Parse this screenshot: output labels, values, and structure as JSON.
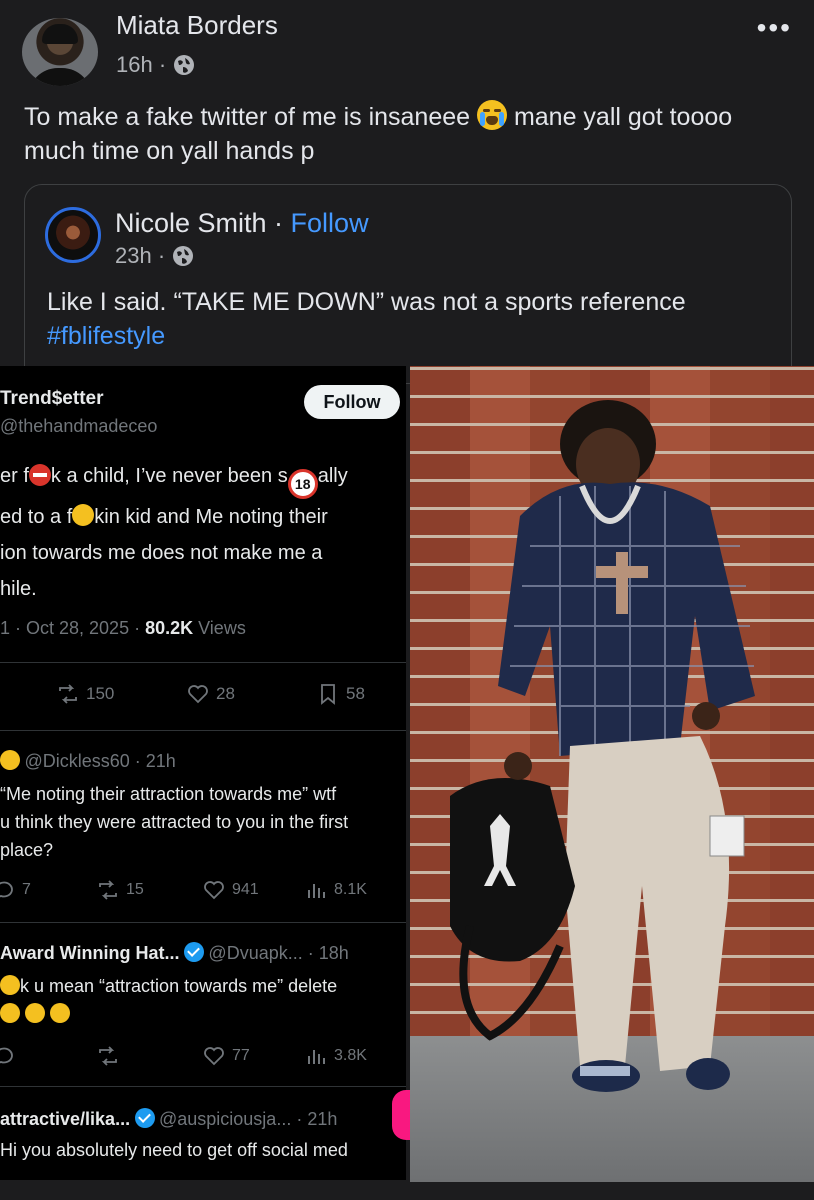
{
  "post": {
    "author_name": "Miata Borders",
    "time": "16h ·",
    "more_label": "•••",
    "text_part1": "To make a fake twitter of me is insaneee",
    "text_part2": "mane yall got toooo much time on yall hands p"
  },
  "shared_post": {
    "author_name": "Nicole Smith",
    "separator": " · ",
    "follow_label": "Follow",
    "time": "23h ·",
    "text": "Like I said. “TAKE ME DOWN” was not a sports reference",
    "hashtag": "#fblifestyle"
  },
  "tweet": {
    "display_name": "Trend$etter",
    "handle": "@thehandmadeceo",
    "follow_label": "Follow",
    "line1a": "er f",
    "line1b": "k a child, I’ve never been s",
    "line1c": "ally",
    "line2a": "ed to a f",
    "line2b": "kin kid and Me noting their",
    "line3": "ion towards me does not make me a",
    "line4": "hile.",
    "date": "1 · Oct 28, 2025 · ",
    "views_count": "80.2K",
    "views_label": " Views",
    "retweets": "150",
    "likes": "28",
    "bookmarks": "58",
    "badge_18": "18"
  },
  "replies": [
    {
      "handle": "@Dickless60 · 21h",
      "line1": "“Me noting their attraction towards me” wtf",
      "line2": "u think they were attracted to you in the first",
      "line3": "place?",
      "replies": "7",
      "retweets": "15",
      "likes": "941",
      "views": "8.1K"
    },
    {
      "name": "Award Winning Hat...",
      "handle": "@Dvuapk... · 18h",
      "line1": "k u mean “attraction towards me” delete",
      "likes": "77",
      "views": "3.8K"
    },
    {
      "name": "attractive/lika...",
      "handle": "@auspiciousja... · 21h",
      "line1": "Hi you absolutely need to get off social med"
    }
  ],
  "colors": {
    "fb_background": "#1c1c1e",
    "fb_link": "#4599ff",
    "x_background": "#000000",
    "x_muted": "#71767b",
    "verified": "#1d9bf0"
  }
}
